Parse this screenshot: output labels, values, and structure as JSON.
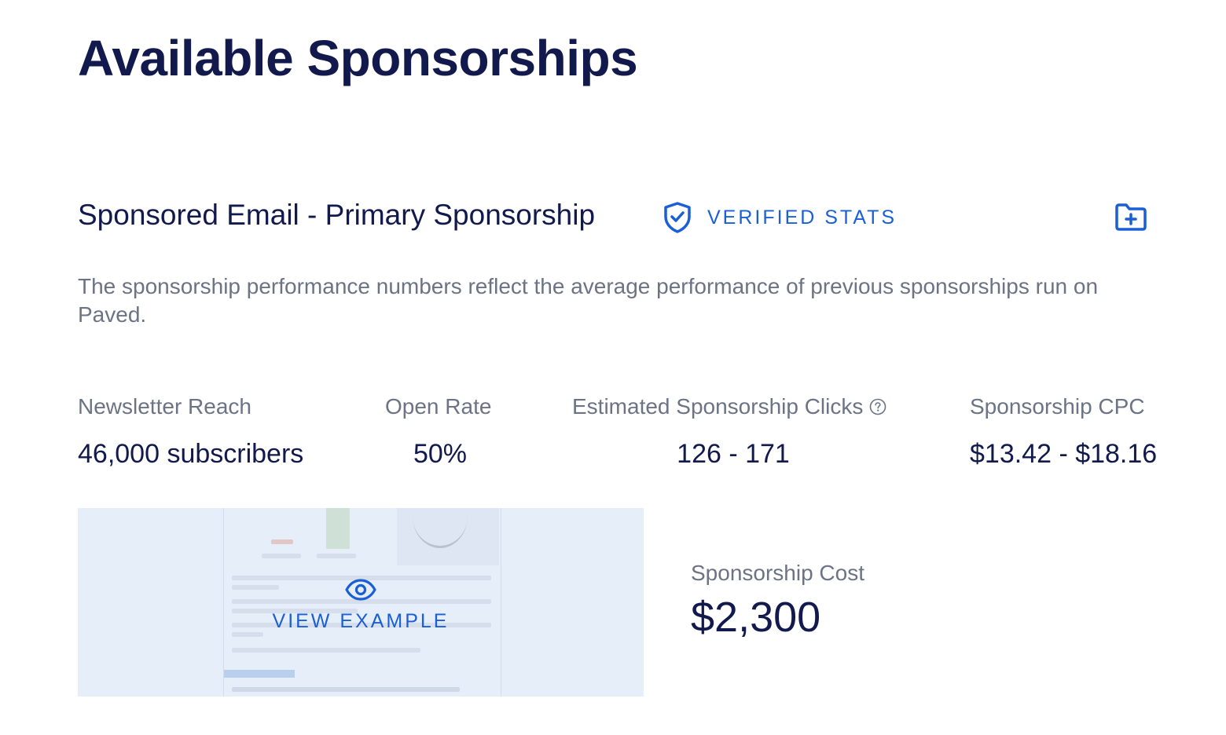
{
  "page": {
    "title": "Available Sponsorships"
  },
  "sponsorship": {
    "title": "Sponsored Email - Primary Sponsorship",
    "verified_label": "VERIFIED STATS",
    "description": "The sponsorship performance numbers reflect the average performance of previous sponsorships run on Paved.",
    "stats": {
      "reach": {
        "label": "Newsletter Reach",
        "value": "46,000 subscribers"
      },
      "open_rate": {
        "label": "Open Rate",
        "value": "50%"
      },
      "clicks": {
        "label": "Estimated Sponsorship Clicks",
        "value": "126 - 171"
      },
      "cpc": {
        "label": "Sponsorship CPC",
        "value": "$13.42 - $18.16"
      }
    },
    "example": {
      "label": "VIEW EXAMPLE"
    },
    "cost": {
      "label": "Sponsorship Cost",
      "value": "$2,300"
    }
  },
  "icons": {
    "verified": "shield-check-icon",
    "save": "folder-plus-icon",
    "help": "question-circle-icon",
    "view": "eye-icon"
  },
  "colors": {
    "heading": "#121a4d",
    "accent": "#1a5fd6",
    "muted": "#6b7384",
    "example_bg": "#e6eef9"
  }
}
